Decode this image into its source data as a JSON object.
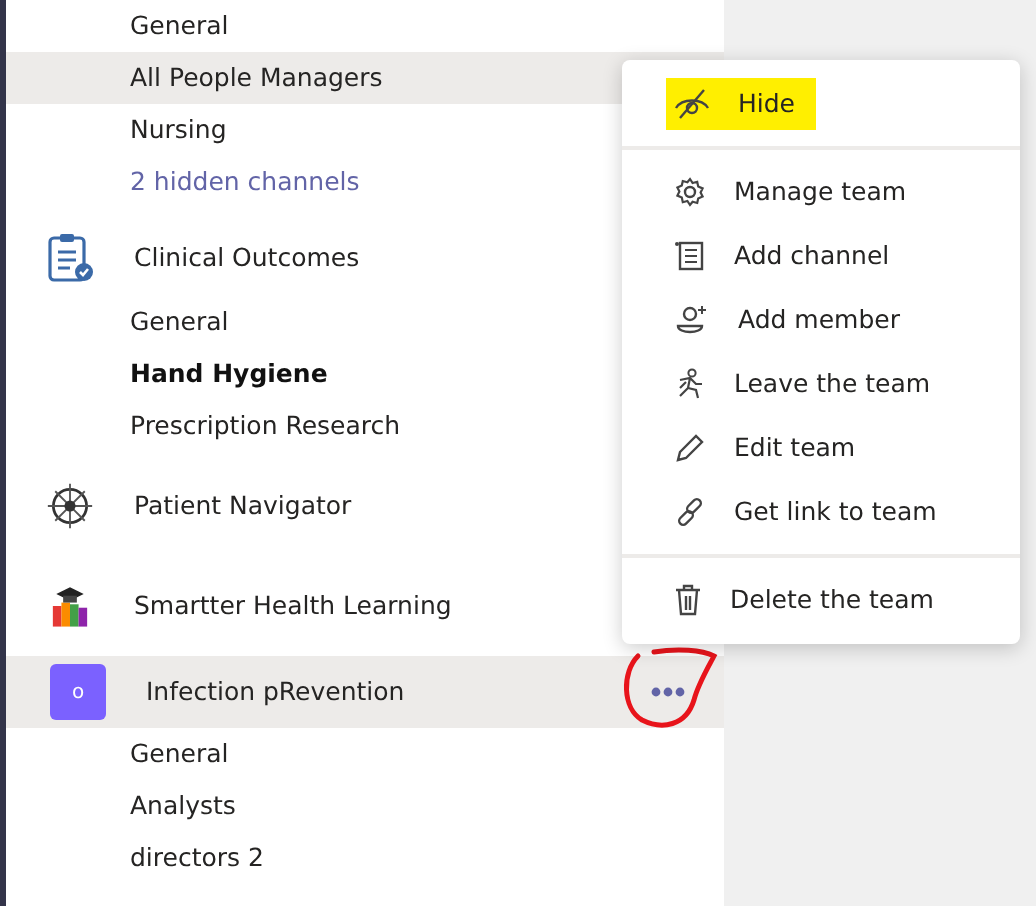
{
  "top_channels": [
    {
      "name": "General",
      "kind": "channel",
      "hovered": false,
      "unread": false
    },
    {
      "name": "All People Managers",
      "kind": "channel",
      "hovered": true,
      "unread": false
    },
    {
      "name": "Nursing",
      "kind": "channel",
      "hovered": false,
      "unread": false
    },
    {
      "name": "2 hidden channels",
      "kind": "link",
      "hovered": false,
      "unread": false
    }
  ],
  "teams": [
    {
      "name": "Clinical Outcomes",
      "kind": "clipboard",
      "hovered": false,
      "circled": false,
      "channels": [
        {
          "name": "General",
          "unread": false
        },
        {
          "name": "Hand Hygiene",
          "unread": true
        },
        {
          "name": "Prescription Research",
          "unread": false
        }
      ]
    },
    {
      "name": "Patient Navigator",
      "kind": "compass",
      "hovered": false,
      "circled": false
    },
    {
      "name": "Smartter Health Learning",
      "kind": "photo",
      "hovered": false,
      "circled": false
    },
    {
      "name": "Infection pRevention",
      "kind": "letter",
      "letter": "o",
      "hovered": true,
      "circled": true,
      "channels": [
        {
          "name": "General",
          "unread": false
        },
        {
          "name": "Analysts",
          "unread": false
        },
        {
          "name": "directors 2",
          "unread": false
        }
      ]
    }
  ],
  "menu": {
    "groups": [
      [
        {
          "label": "Hide",
          "marked": true
        }
      ],
      [
        {
          "label": "Manage team",
          "marked": false
        },
        {
          "label": "Add channel",
          "marked": false
        },
        {
          "label": "Add member",
          "marked": false
        },
        {
          "label": "Leave the team",
          "marked": false
        },
        {
          "label": "Edit team",
          "marked": false
        },
        {
          "label": "Get link to team",
          "marked": false
        }
      ],
      [
        {
          "label": "Delete the team",
          "marked": false
        }
      ]
    ]
  }
}
